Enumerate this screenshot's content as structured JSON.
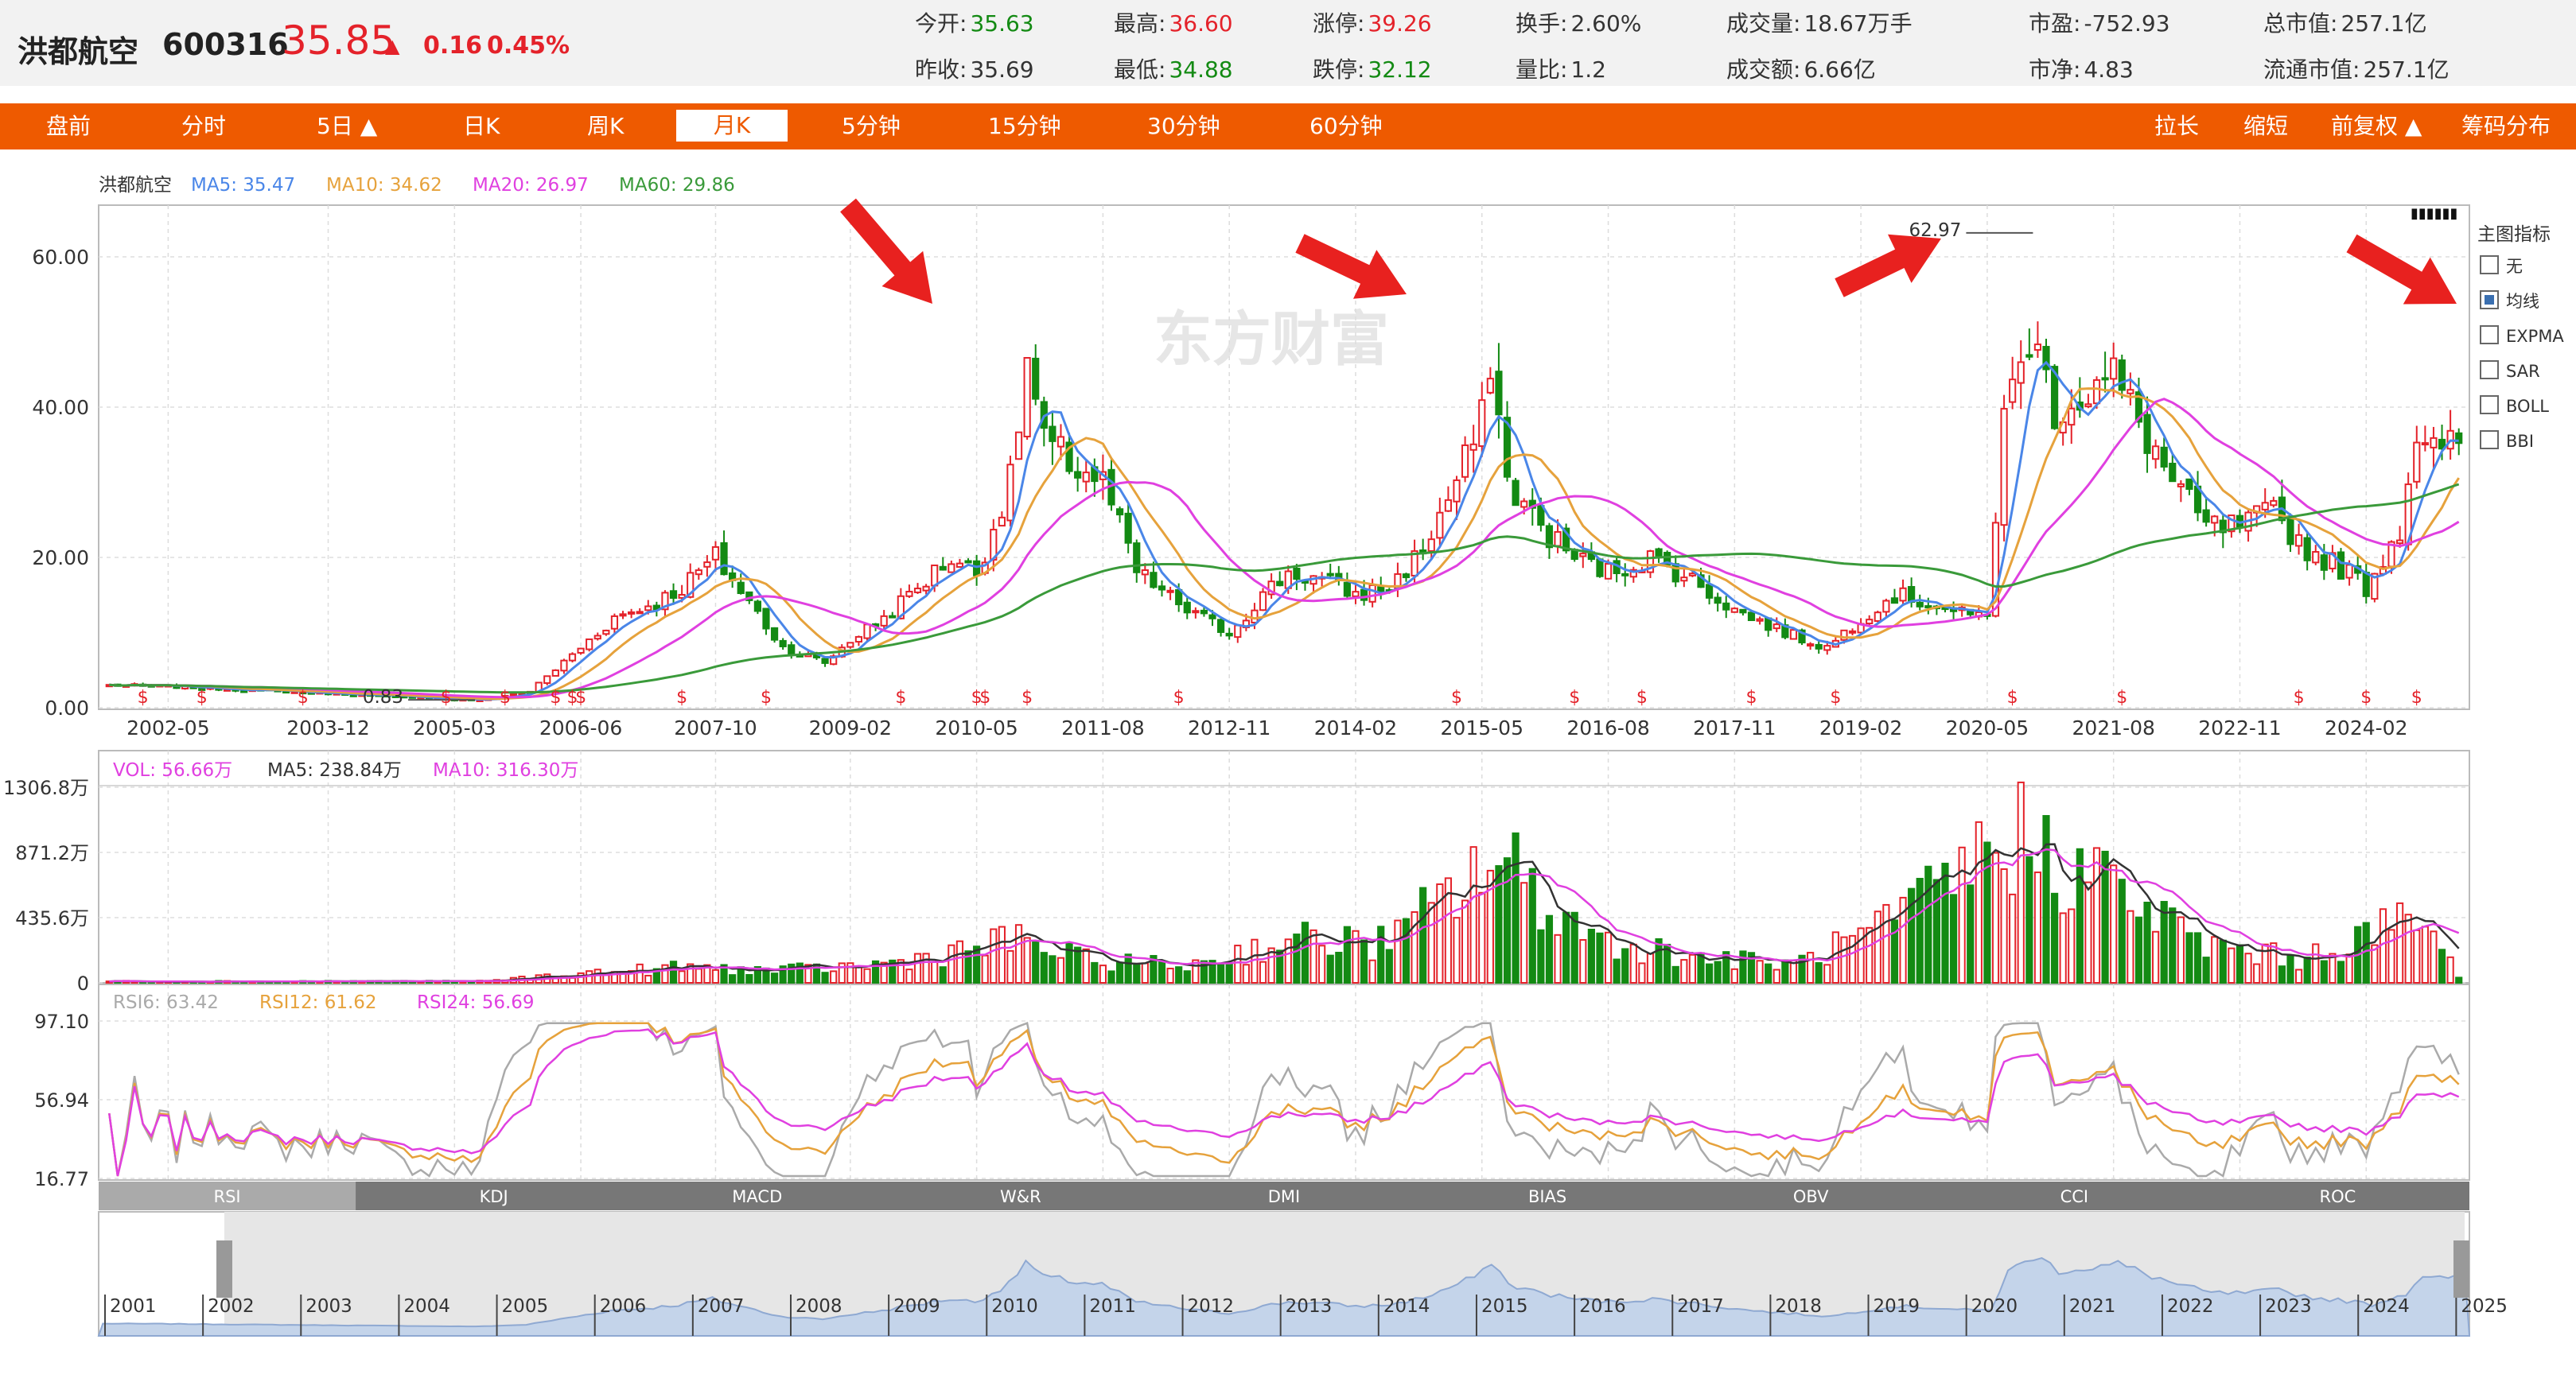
{
  "header": {
    "name": "洪都航空",
    "code": "600316",
    "price": "35.85",
    "change": "0.16",
    "change_pct": "0.45%",
    "quotes": [
      {
        "label": "今开:",
        "value": "35.63",
        "color": "grn"
      },
      {
        "label": "昨收:",
        "value": "35.69",
        "color": "blk"
      },
      {
        "label": "最高:",
        "value": "36.60",
        "color": "red"
      },
      {
        "label": "最低:",
        "value": "34.88",
        "color": "grn"
      },
      {
        "label": "涨停:",
        "value": "39.26",
        "color": "red"
      },
      {
        "label": "跌停:",
        "value": "32.12",
        "color": "grn"
      },
      {
        "label": "换手:",
        "value": "2.60%",
        "color": "blk"
      },
      {
        "label": "量比:",
        "value": "1.2",
        "color": "blk"
      },
      {
        "label": "成交量:",
        "value": "18.67万手",
        "color": "blk"
      },
      {
        "label": "成交额:",
        "value": "6.66亿",
        "color": "blk"
      },
      {
        "label": "市盈:",
        "value": "-752.93",
        "color": "blk"
      },
      {
        "label": "市净:",
        "value": "4.83",
        "color": "blk"
      },
      {
        "label": "总市值:",
        "value": "257.1亿",
        "color": "blk"
      },
      {
        "label": "流通市值:",
        "value": "257.1亿",
        "color": "blk"
      }
    ]
  },
  "tabs": [
    "盘前",
    "分时",
    "5日 ▲",
    "日K",
    "周K",
    "月K",
    "5分钟",
    "15分钟",
    "30分钟",
    "60分钟"
  ],
  "selected_tab": "月K",
  "right_tabs": [
    "拉长",
    "缩短",
    "前复权 ▲",
    "筹码分布"
  ],
  "indicator_panel": {
    "title": "主图指标",
    "options": [
      {
        "label": "无",
        "checked": false
      },
      {
        "label": "均线",
        "checked": true
      },
      {
        "label": "EXPMA",
        "checked": false
      },
      {
        "label": "SAR",
        "checked": false
      },
      {
        "label": "BOLL",
        "checked": false
      },
      {
        "label": "BBI",
        "checked": false
      }
    ]
  },
  "watermark": "东方财富",
  "bottom_tabs": [
    "RSI",
    "KDJ",
    "MACD",
    "W&R",
    "DMI",
    "BIAS",
    "OBV",
    "CCI",
    "ROC"
  ],
  "selected_bottom_tab": "RSI",
  "colors": {
    "up": "#e4222a",
    "down": "#138a13",
    "brand": "#ee5a00",
    "ma5": "#4a86e8",
    "ma10": "#e6a23c",
    "ma20": "#e040e0",
    "ma60": "#3a9a3a"
  },
  "chart_data": [
    {
      "type": "candlestick",
      "title": "洪都航空",
      "legend": [
        {
          "name": "MA5",
          "value": "35.47",
          "color": "#4a86e8"
        },
        {
          "name": "MA10",
          "value": "34.62",
          "color": "#e6a23c"
        },
        {
          "name": "MA20",
          "value": "26.97",
          "color": "#e040e0"
        },
        {
          "name": "MA60",
          "value": "29.86",
          "color": "#3a9a3a"
        }
      ],
      "y_ticks": [
        "60.00",
        "40.00",
        "20.00",
        "0.00"
      ],
      "ylim": [
        -3,
        66
      ],
      "x_ticks": [
        "2002-05",
        "2003-12",
        "2005-03",
        "2006-06",
        "2007-10",
        "2009-02",
        "2010-05",
        "2011-08",
        "2012-11",
        "2014-02",
        "2015-05",
        "2016-08",
        "2017-11",
        "2019-02",
        "2020-05",
        "2021-08",
        "2022-11",
        "2024-02"
      ],
      "x_range": [
        "2001-10",
        "2025-01"
      ],
      "annotations": [
        {
          "text": "62.97",
          "x": "2020-11",
          "y": 62.97
        },
        {
          "text": "0.83",
          "x": "2005-06",
          "y": 0.83
        }
      ],
      "close_anchors": [
        [
          "2001-10",
          3.0
        ],
        [
          "2002-06",
          2.8
        ],
        [
          "2003-06",
          2.2
        ],
        [
          "2004-06",
          1.6
        ],
        [
          "2005-06",
          1.0
        ],
        [
          "2005-12",
          2.2
        ],
        [
          "2006-06",
          8
        ],
        [
          "2006-10",
          12
        ],
        [
          "2007-03",
          14
        ],
        [
          "2007-06",
          16
        ],
        [
          "2007-10",
          20
        ],
        [
          "2008-02",
          14
        ],
        [
          "2008-06",
          8
        ],
        [
          "2008-11",
          6
        ],
        [
          "2009-02",
          9
        ],
        [
          "2009-06",
          12
        ],
        [
          "2009-10",
          16
        ],
        [
          "2010-02",
          20
        ],
        [
          "2010-05",
          18
        ],
        [
          "2010-09",
          30
        ],
        [
          "2010-11",
          46
        ],
        [
          "2011-01",
          35
        ],
        [
          "2011-05",
          32
        ],
        [
          "2011-08",
          30
        ],
        [
          "2011-12",
          18
        ],
        [
          "2012-06",
          13
        ],
        [
          "2012-11",
          10
        ],
        [
          "2013-03",
          15
        ],
        [
          "2013-06",
          18
        ],
        [
          "2013-10",
          17
        ],
        [
          "2014-02",
          15
        ],
        [
          "2014-06",
          16
        ],
        [
          "2014-10",
          21
        ],
        [
          "2015-02",
          30
        ],
        [
          "2015-05",
          38
        ],
        [
          "2015-06",
          47
        ],
        [
          "2015-08",
          30
        ],
        [
          "2015-12",
          24
        ],
        [
          "2016-04",
          20
        ],
        [
          "2016-08",
          18
        ],
        [
          "2017-01",
          20
        ],
        [
          "2017-06",
          17
        ],
        [
          "2017-11",
          13
        ],
        [
          "2018-05",
          10
        ],
        [
          "2018-10",
          8
        ],
        [
          "2019-02",
          12
        ],
        [
          "2019-06",
          15
        ],
        [
          "2019-10",
          14
        ],
        [
          "2020-03",
          12
        ],
        [
          "2020-05",
          13
        ],
        [
          "2020-07",
          38
        ],
        [
          "2020-10",
          50
        ],
        [
          "2021-01",
          40
        ],
        [
          "2021-05",
          42
        ],
        [
          "2021-08",
          44
        ],
        [
          "2021-12",
          36
        ],
        [
          "2022-03",
          30
        ],
        [
          "2022-07",
          24
        ],
        [
          "2022-11",
          24
        ],
        [
          "2023-03",
          26
        ],
        [
          "2023-07",
          21
        ],
        [
          "2023-12",
          18
        ],
        [
          "2024-02",
          16
        ],
        [
          "2024-06",
          24
        ],
        [
          "2024-08",
          37
        ],
        [
          "2024-11",
          33
        ],
        [
          "2025-01",
          36
        ]
      ]
    },
    {
      "type": "bar",
      "title": "VOL",
      "legend": [
        {
          "name": "VOL",
          "value": "56.66万",
          "color": "#e040e0"
        },
        {
          "name": "MA5",
          "value": "238.84万",
          "color": "#333333"
        },
        {
          "name": "MA10",
          "value": "316.30万",
          "color": "#e040e0"
        }
      ],
      "y_ticks": [
        "1306.8万",
        "871.2万",
        "435.6万",
        "0"
      ],
      "ylim": [
        0,
        1306.8
      ],
      "unit": "万",
      "volume_anchors": [
        [
          "2001-10",
          10
        ],
        [
          "2005-06",
          10
        ],
        [
          "2006-06",
          60
        ],
        [
          "2007-06",
          100
        ],
        [
          "2008-06",
          80
        ],
        [
          "2009-06",
          120
        ],
        [
          "2010-10",
          280
        ],
        [
          "2011-06",
          150
        ],
        [
          "2012-06",
          110
        ],
        [
          "2013-06",
          280
        ],
        [
          "2014-06",
          260
        ],
        [
          "2015-03",
          650
        ],
        [
          "2015-06",
          820
        ],
        [
          "2016-06",
          300
        ],
        [
          "2017-06",
          170
        ],
        [
          "2018-06",
          120
        ],
        [
          "2019-06",
          380
        ],
        [
          "2020-08",
          960
        ],
        [
          "2021-06",
          700
        ],
        [
          "2022-06",
          260
        ],
        [
          "2023-06",
          150
        ],
        [
          "2024-08",
          420
        ],
        [
          "2025-01",
          60
        ]
      ]
    },
    {
      "type": "line",
      "title": "RSI",
      "legend": [
        {
          "name": "RSI6",
          "value": "63.42",
          "color": "#aaaaaa"
        },
        {
          "name": "RSI12",
          "value": "61.62",
          "color": "#e6a23c"
        },
        {
          "name": "RSI24",
          "value": "56.69",
          "color": "#e040e0"
        }
      ],
      "y_ticks": [
        "97.10",
        "56.94",
        "16.77"
      ],
      "ylim": [
        16.77,
        97.1
      ]
    },
    {
      "type": "area",
      "title": "navigator",
      "x_ticks": [
        "2001",
        "2002",
        "2003",
        "2004",
        "2005",
        "2006",
        "2007",
        "2008",
        "2009",
        "2010",
        "2011",
        "2012",
        "2013",
        "2014",
        "2015",
        "2016",
        "2017",
        "2018",
        "2019",
        "2020",
        "2021",
        "2022",
        "2023",
        "2024",
        "2025"
      ]
    }
  ]
}
